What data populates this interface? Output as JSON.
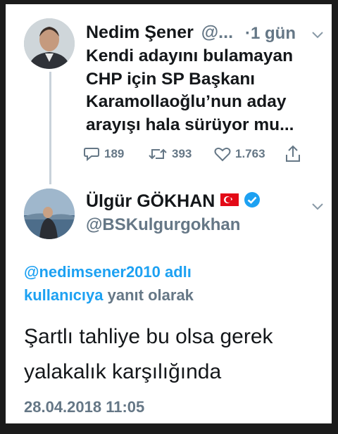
{
  "first_tweet": {
    "author_name": "Nedim Şener",
    "handle_truncated": "@...",
    "time": "·1 gün",
    "text_lines": [
      "Kendi adayını bulamayan",
      "CHP için SP Başkanı",
      "Karamollaoğlu’nun aday",
      "arayışı hala sürüyor mu..."
    ],
    "actions": {
      "replies": "189",
      "retweets": "393",
      "likes": "1.763"
    }
  },
  "second_tweet": {
    "author_name": "Ülgür GÖKHAN",
    "handle": "@BSKulgurgokhan",
    "reply_context_mention": "@nedimsener2010 adlı",
    "reply_context_line2_link": "kullanıcıya",
    "reply_context_line2_rest": "yanıt olarak",
    "text_lines": [
      "Şartlı tahliye bu olsa gerek",
      "yalakalık karşılığında"
    ],
    "timestamp": "28.04.2018 11:05"
  },
  "icons": {
    "reply": "reply-icon",
    "retweet": "retweet-icon",
    "like": "heart-icon",
    "share": "share-icon",
    "verified": "verified-badge-icon",
    "flag": "turkey-flag-icon",
    "menu": "chevron-down-icon"
  },
  "colors": {
    "text": "#14171a",
    "muted": "#657786",
    "link": "#1da1f2",
    "verified": "#1da1f2",
    "flag": "#e30a17"
  }
}
